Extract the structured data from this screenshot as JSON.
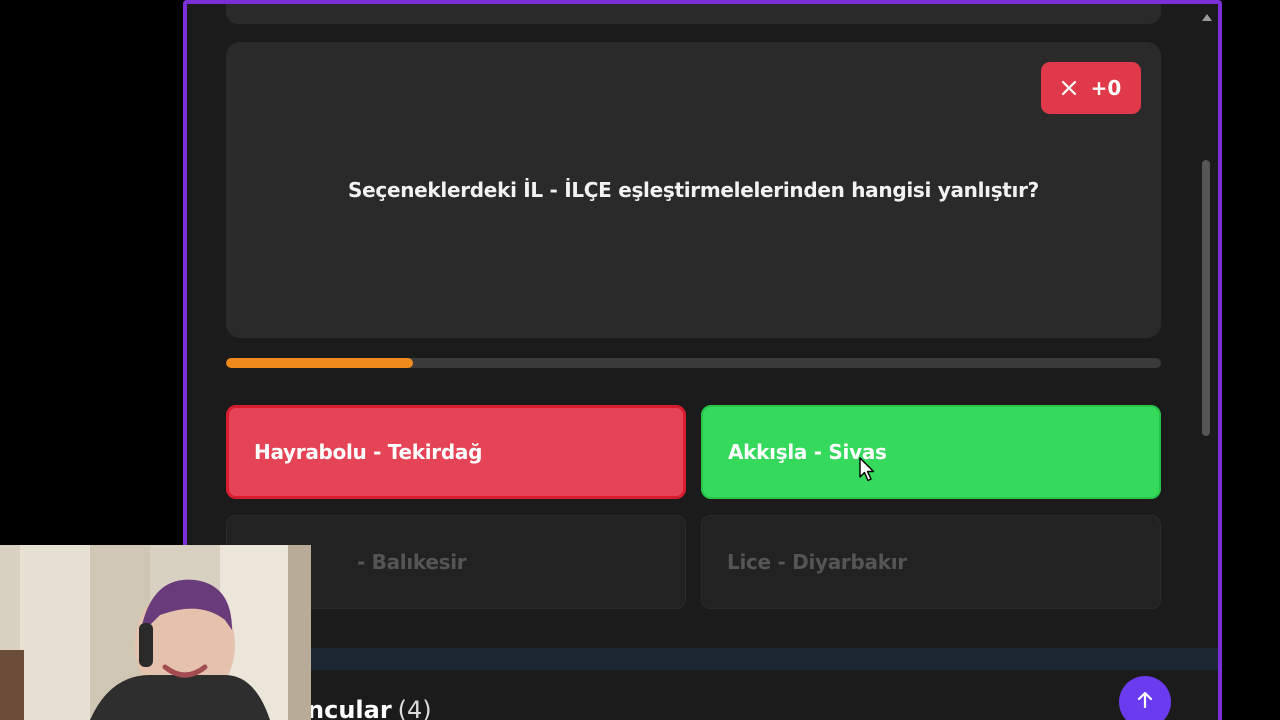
{
  "question": {
    "text": "Seçeneklerdeki İL - İLÇE eşleştirmelelerinden hangisi yanlıştır?",
    "score_label": "+0",
    "score_color": "#e03a4a"
  },
  "progress": {
    "fraction": 0.2
  },
  "answers": [
    {
      "label": "Hayrabolu - Tekirdağ",
      "state": "wrong"
    },
    {
      "label": "Akkışla - Sivas",
      "state": "correct"
    },
    {
      "label": "- Balıkesir",
      "state": "disabled"
    },
    {
      "label": "Lice - Diyarbakır",
      "state": "disabled"
    }
  ],
  "section": {
    "title": "ncular",
    "count": "(4)"
  },
  "icons": {
    "score": "close-icon",
    "scroll_top": "arrow-up-icon",
    "pointer": "mouse-cursor-icon"
  },
  "colors": {
    "frame_border": "#7b2fd6",
    "wrong": "#e44455",
    "correct": "#35d95b",
    "progress": "#f08a1d",
    "scroll_top_button": "#6b3bf0"
  }
}
